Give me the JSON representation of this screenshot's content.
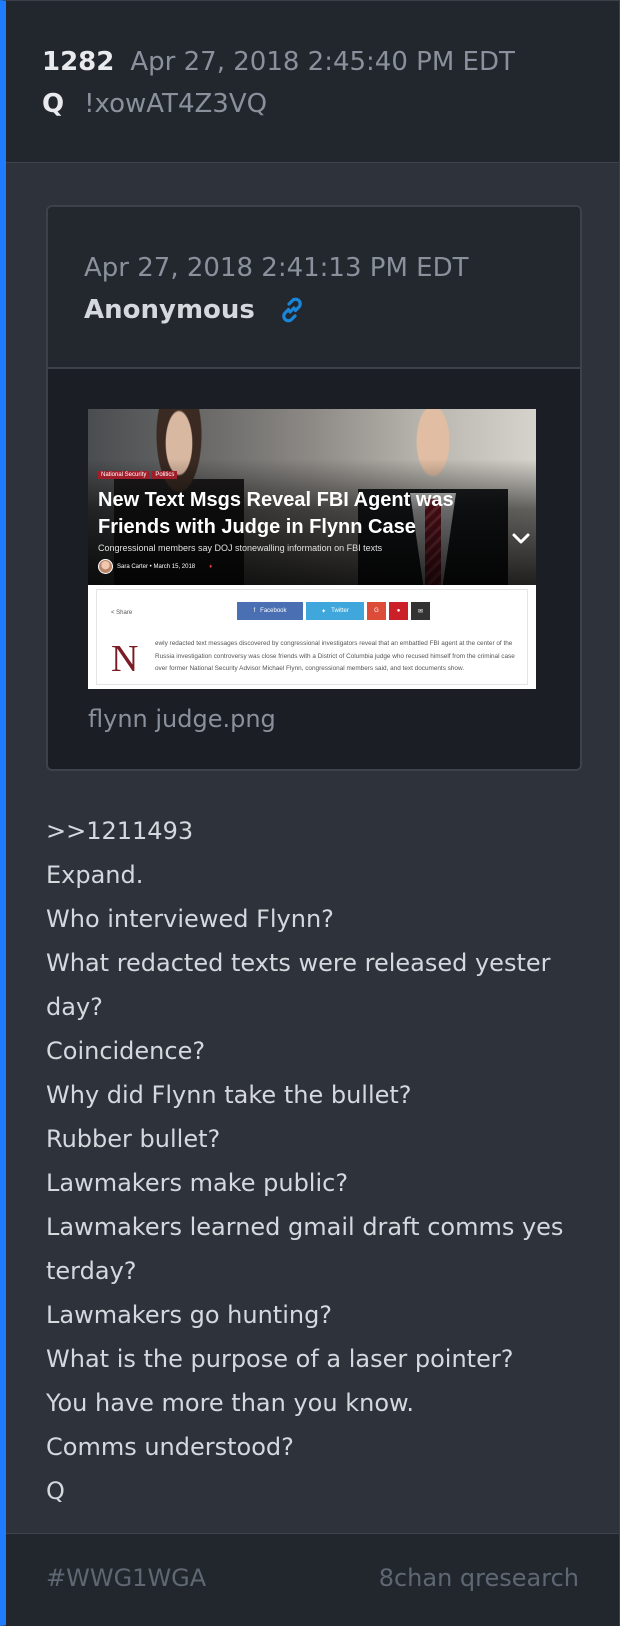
{
  "post": {
    "number": "1282",
    "date": "Apr 27, 2018 2:45:40 PM EDT",
    "author": "Q",
    "tripcode": "!xowAT4Z3VQ"
  },
  "quoted_post": {
    "date": "Apr 27, 2018 2:41:13 PM EDT",
    "author": "Anonymous",
    "link_icon": "link-icon",
    "attachment": {
      "filename": "flynn judge.png",
      "tags": [
        "National Security",
        "Politics"
      ],
      "headline": "New Text Msgs Reveal FBI Agent was Friends with Judge in Flynn Case",
      "subheadline": "Congressional members say DOJ stonewalling information on FBI texts",
      "byline": "Sara Carter • March 15, 2018",
      "share_label": "Share",
      "share_buttons": [
        "Facebook",
        "Twitter"
      ],
      "dropcap": "N",
      "paragraph": "ewly redacted text messages discovered by congressional investigators reveal that an embattled FBI agent at the center of the Russia investigation controversy was close friends with a District of Columbia judge who recused himself from the criminal case over former National Security Advisor Michael Flynn, congressional members said, and text documents show."
    }
  },
  "body_lines": [
    ">>1211493",
    "Expand.",
    "Who interviewed Flynn?",
    "What redacted texts were released yester",
    "day?",
    "Coincidence?",
    "Why did Flynn take the bullet?",
    "Rubber bullet?",
    "Lawmakers make public?",
    "Lawmakers learned gmail draft comms yes",
    "terday?",
    "Lawmakers go hunting?",
    "What is the purpose of a laser pointer?",
    "You have more than you know.",
    "Comms understood?",
    "Q"
  ],
  "footer": {
    "hashtag": "#WWG1WGA",
    "source": "8chan qresearch"
  },
  "colors": {
    "accent_bar": "#1f7cff",
    "link_icon": "#1a86d9",
    "background": "#2d323b"
  }
}
